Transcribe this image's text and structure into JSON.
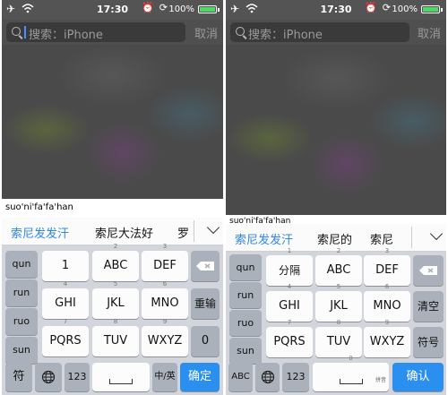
{
  "left": {
    "status": {
      "time": "17:30",
      "battery": "100%",
      "battery_level": 1.0
    },
    "search": {
      "placeholder": "搜索：iPhone",
      "cancel": "取消"
    },
    "pinyin": "suo'ni'fa'fa'han",
    "candidates": [
      "索尼发发汗",
      "索尼大法好",
      "罗"
    ],
    "keyboard": {
      "side": [
        "qun",
        "run",
        "ruo",
        "sun"
      ],
      "grid": [
        [
          {
            "num": "",
            "label": "1"
          },
          {
            "num": "2",
            "label": "ABC"
          },
          {
            "num": "3",
            "label": "DEF"
          }
        ],
        [
          {
            "num": "4",
            "label": "GHI"
          },
          {
            "num": "5",
            "label": "JKL"
          },
          {
            "num": "6",
            "label": "MNO"
          }
        ],
        [
          {
            "num": "7",
            "label": "PQRS"
          },
          {
            "num": "8",
            "label": "TUV"
          },
          {
            "num": "9",
            "label": "WXYZ"
          }
        ]
      ],
      "right": [
        "重输",
        "0"
      ],
      "bottom": {
        "symbol": "符",
        "num": "123",
        "lang": "中/英",
        "confirm": "确定"
      }
    }
  },
  "right": {
    "status": {
      "time": "17:30",
      "battery": "100%",
      "battery_level": 1.0
    },
    "search": {
      "placeholder": "搜索：iPhone",
      "cancel": "取消"
    },
    "pinyin": "suo'ni'fa'fa'han",
    "candidates": [
      "索尼发发汗",
      "索尼的",
      "索尼"
    ],
    "keyboard": {
      "side": [
        "qun",
        "run",
        "ruo",
        "sun"
      ],
      "grid": [
        [
          {
            "num": "1",
            "label": "分隔"
          },
          {
            "num": "2",
            "label": "ABC"
          },
          {
            "num": "3",
            "label": "DEF"
          }
        ],
        [
          {
            "num": "4",
            "label": "GHI"
          },
          {
            "num": "5",
            "label": "JKL"
          },
          {
            "num": "6",
            "label": "MNO"
          }
        ],
        [
          {
            "num": "7",
            "label": "PQRS"
          },
          {
            "num": "8",
            "label": "TUV"
          },
          {
            "num": "9",
            "label": "WXYZ"
          }
        ]
      ],
      "right": [
        "清空",
        "符号"
      ],
      "bottom": {
        "abc": "ABC",
        "num": "123",
        "space_num": "0",
        "space_sub": "拼音",
        "confirm": "确认"
      }
    }
  },
  "colors": {
    "accent": "#2b8ff0",
    "candidate_highlight": "#2f86e6"
  }
}
